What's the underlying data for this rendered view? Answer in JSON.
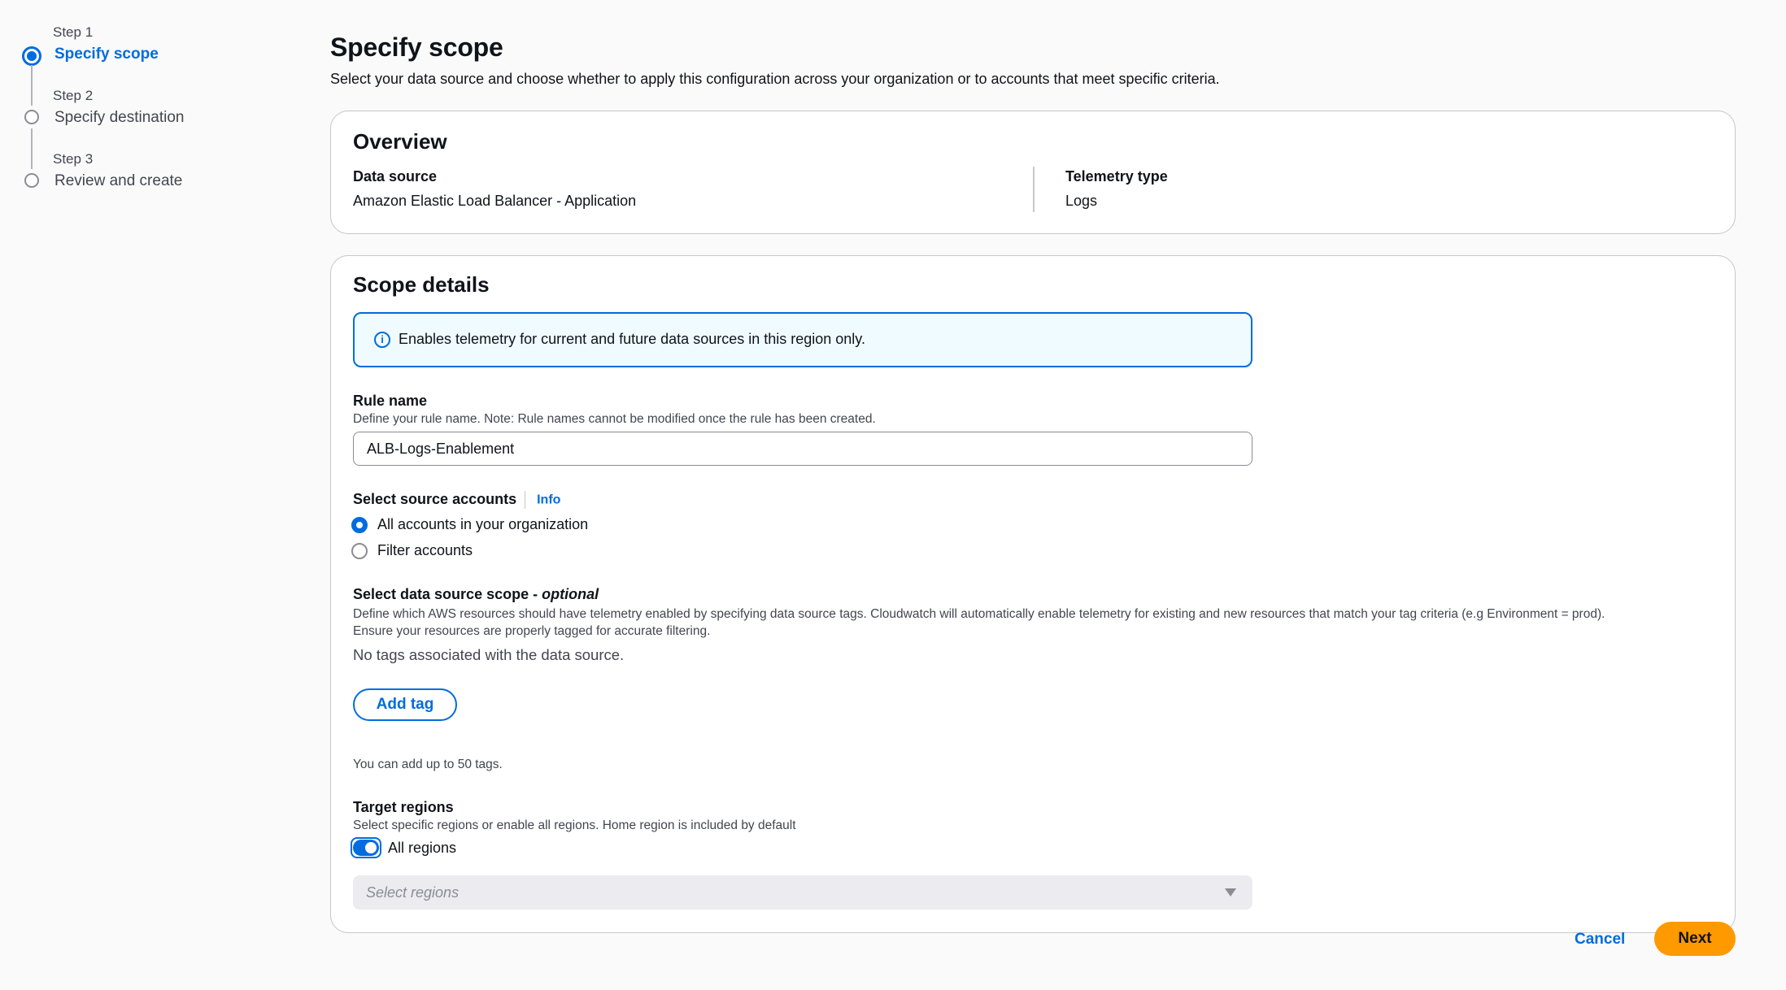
{
  "wizard": {
    "steps": [
      {
        "number": "Step 1",
        "title": "Specify scope",
        "state": "active"
      },
      {
        "number": "Step 2",
        "title": "Specify destination",
        "state": "inactive"
      },
      {
        "number": "Step 3",
        "title": "Review and create",
        "state": "inactive"
      }
    ]
  },
  "page": {
    "title": "Specify scope",
    "description": "Select your data source and choose whether to apply this configuration across your organization or to accounts that meet specific criteria."
  },
  "overview": {
    "heading": "Overview",
    "data_source_label": "Data source",
    "data_source_value": "Amazon Elastic Load Balancer - Application",
    "telemetry_type_label": "Telemetry type",
    "telemetry_type_value": "Logs"
  },
  "scope_details": {
    "heading": "Scope details",
    "info_alert": "Enables telemetry for current and future data sources in this region only.",
    "info_icon": "info-circle-icon",
    "rule_name": {
      "label": "Rule name",
      "description": "Define your rule name. Note: Rule names cannot be modified once the rule has been created.",
      "value": "ALB-Logs-Enablement"
    },
    "source_accounts": {
      "label": "Select source accounts",
      "info_link": "Info",
      "options": [
        {
          "label": "All accounts in your organization",
          "checked": true
        },
        {
          "label": "Filter accounts",
          "checked": false
        }
      ]
    },
    "data_source_scope": {
      "label": "Select data source scope - ",
      "label_optional": "optional",
      "description_line1": "Define which AWS resources should have telemetry enabled by specifying data source tags. Cloudwatch will automatically enable telemetry for existing and new resources that match your tag criteria (e.g Environment = prod).",
      "description_line2": "Ensure your resources are properly tagged for accurate filtering.",
      "empty_text": "No tags associated with the data source.",
      "add_tag_button": "Add tag",
      "tag_limit_text": "You can add up to 50 tags."
    },
    "target_regions": {
      "label": "Target regions",
      "description": "Select specific regions or enable all regions. Home region is included by default",
      "toggle_label": "All regions",
      "toggle_on": true,
      "select_placeholder": "Select regions",
      "select_disabled": true
    }
  },
  "actions": {
    "cancel": "Cancel",
    "next": "Next"
  },
  "colors": {
    "accent": "#006ce0",
    "primary_button": "#ff9900",
    "info_alert_background": "#f0fbff"
  }
}
